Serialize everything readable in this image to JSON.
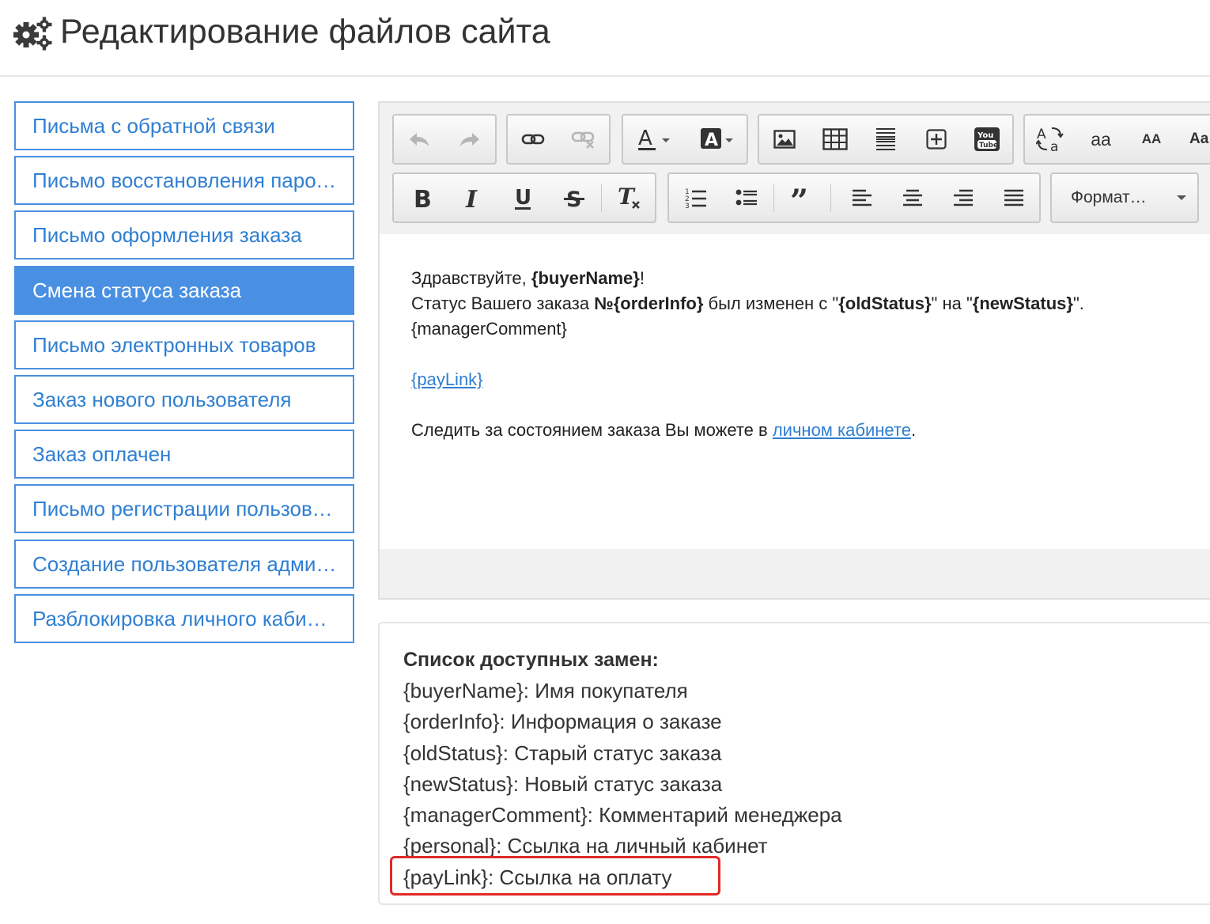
{
  "header": {
    "title": "Редактирование файлов сайта"
  },
  "sidebar": {
    "items": [
      {
        "label": "Письма с обратной связи",
        "active": false
      },
      {
        "label": "Письмо восстановления пароля",
        "active": false
      },
      {
        "label": "Письмо оформления заказа",
        "active": false
      },
      {
        "label": "Смена статуса заказа",
        "active": true
      },
      {
        "label": "Письмо электронных товаров",
        "active": false
      },
      {
        "label": "Заказ нового пользователя",
        "active": false
      },
      {
        "label": "Заказ оплачен",
        "active": false
      },
      {
        "label": "Письмо регистрации пользователя",
        "active": false
      },
      {
        "label": "Создание пользователя администратором",
        "active": false
      },
      {
        "label": "Разблокировка личного кабинета",
        "active": false
      }
    ]
  },
  "toolbar": {
    "format_label": "Формат…",
    "icons": [
      "undo-icon",
      "redo-icon",
      "link-icon",
      "unlink-icon",
      "font-color-icon",
      "background-color-icon",
      "image-icon",
      "table-icon",
      "horizontal-rule-icon",
      "insert-plus-icon",
      "youtube-icon",
      "case-toggle-icon",
      "lowercase-icon",
      "uppercase-icon",
      "bold-icon",
      "italic-icon",
      "underline-icon",
      "strikethrough-icon",
      "remove-format-icon",
      "ordered-list-icon",
      "unordered-list-icon",
      "blockquote-icon",
      "align-left-icon",
      "align-center-icon",
      "align-right-icon",
      "align-justify-icon"
    ],
    "lowercase_label": "aa",
    "uppercase_label": "AA",
    "partial_label": "Aa"
  },
  "content": {
    "greeting_prefix": "Здравствуйте, ",
    "greeting_var": "{buyerName}",
    "greeting_suffix": "!",
    "status_prefix": "Статус Вашего заказа ",
    "status_var_order": "№{orderInfo}",
    "status_mid1": " был изменен с \"",
    "status_var_old": "{oldStatus}",
    "status_mid2": "\" на \"",
    "status_var_new": "{newStatus}",
    "status_suffix": "\".",
    "manager_comment": "{managerComment}",
    "paylink": "{payLink}",
    "follow_prefix": "Следить за состоянием заказа Вы можете в ",
    "follow_link": "личном кабинете",
    "follow_suffix": "."
  },
  "legend": {
    "title": "Список доступных замен:",
    "rows": [
      "{buyerName}: Имя покупателя",
      "{orderInfo}: Информация о заказе",
      "{oldStatus}: Старый статус заказа",
      "{newStatus}: Новый статус заказа",
      "{managerComment}: Комментарий менеджера",
      "{personal}: Ссылка на личный кабинет",
      "{payLink}: Ссылка на оплату"
    ]
  },
  "colors": {
    "accent": "#4a90e2",
    "link": "#2f7fd2",
    "highlight": "#e02b27"
  }
}
